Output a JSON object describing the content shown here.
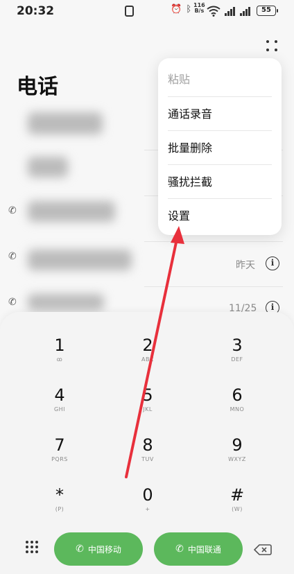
{
  "status_bar": {
    "time": "20:32",
    "net_speed_value": "116",
    "net_speed_unit": "B/s",
    "battery": "55"
  },
  "header": {
    "title": "电话"
  },
  "call_log": [
    {
      "date": ""
    },
    {
      "date": ""
    },
    {
      "date": ""
    },
    {
      "date": "昨天"
    },
    {
      "date": "11/25"
    }
  ],
  "menu": {
    "items": [
      "粘贴",
      "通话录音",
      "批量删除",
      "骚扰拦截",
      "设置"
    ]
  },
  "dialpad": {
    "keys": [
      {
        "num": "1",
        "sub": "ꝏ"
      },
      {
        "num": "2",
        "sub": "ABC"
      },
      {
        "num": "3",
        "sub": "DEF"
      },
      {
        "num": "4",
        "sub": "GHI"
      },
      {
        "num": "5",
        "sub": "JKL"
      },
      {
        "num": "6",
        "sub": "MNO"
      },
      {
        "num": "7",
        "sub": "PQRS"
      },
      {
        "num": "8",
        "sub": "TUV"
      },
      {
        "num": "9",
        "sub": "WXYZ"
      },
      {
        "num": "*",
        "sub": "(P)"
      },
      {
        "num": "0",
        "sub": "+"
      },
      {
        "num": "#",
        "sub": "(W)"
      }
    ]
  },
  "sim_buttons": [
    {
      "label": "中国移动",
      "sim": "1"
    },
    {
      "label": "中国联通",
      "sim": "2"
    }
  ],
  "colors": {
    "call_green": "#5cb85c",
    "annotation_red": "#e8303c"
  }
}
